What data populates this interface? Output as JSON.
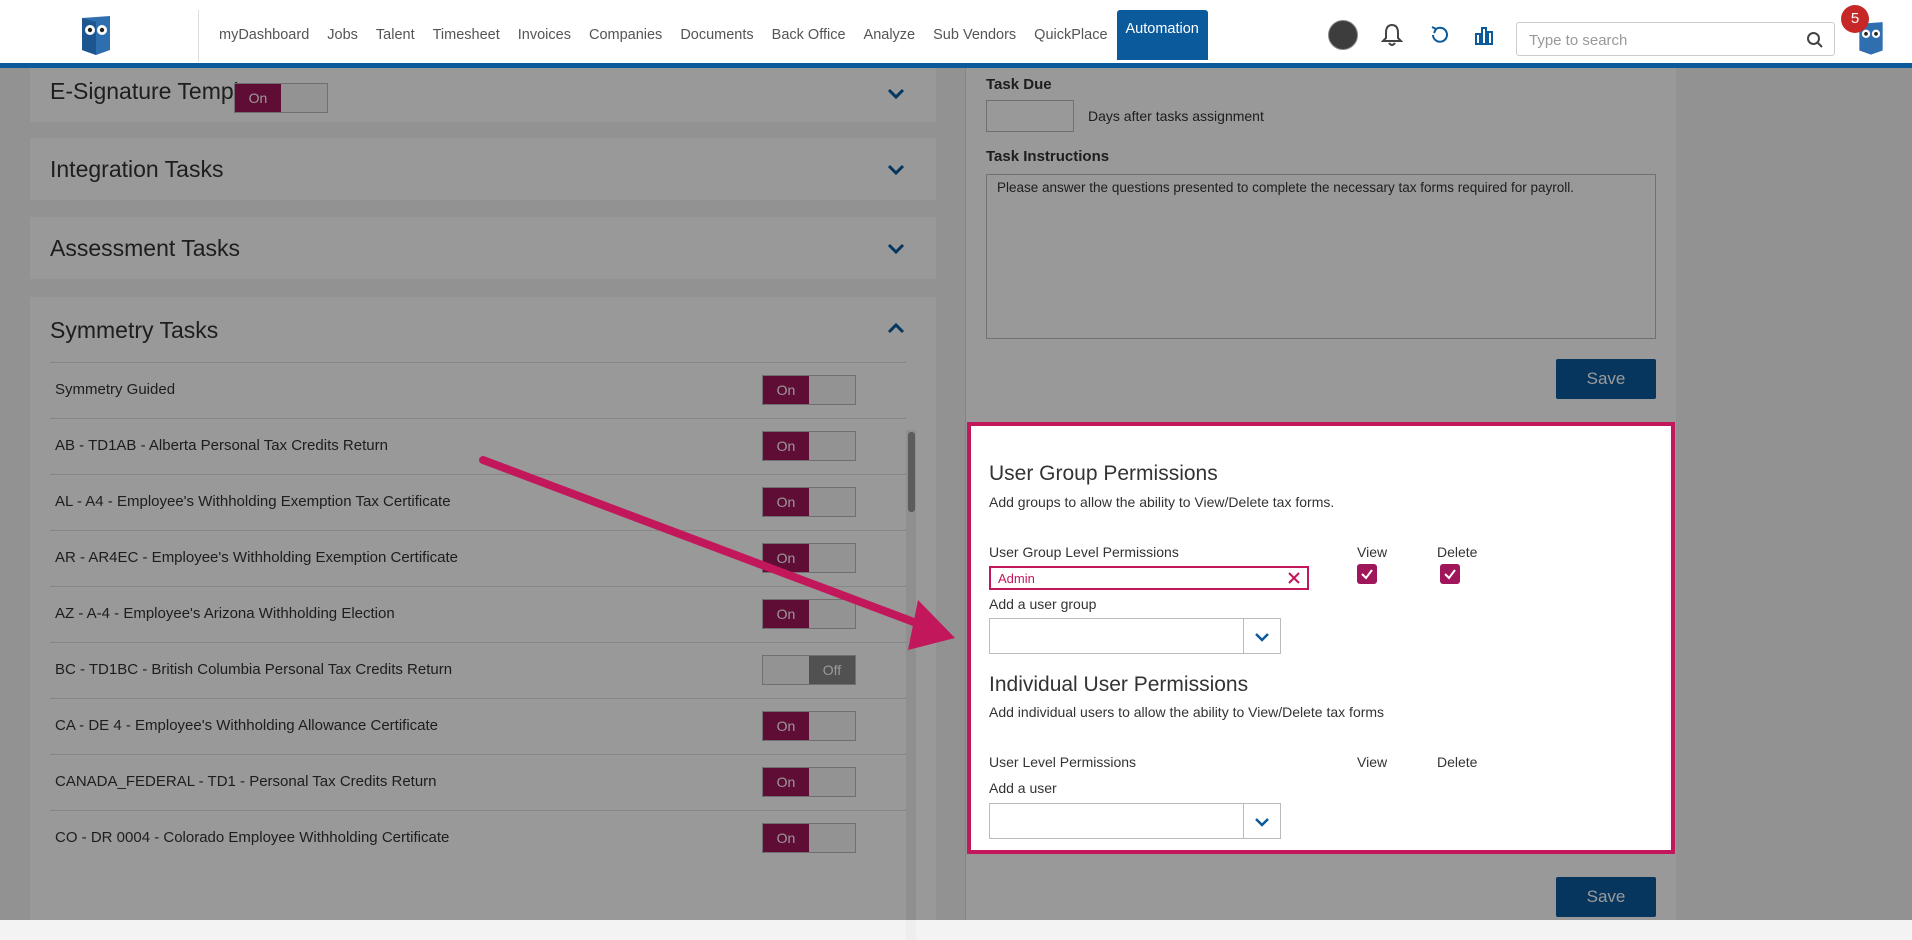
{
  "nav": {
    "items": [
      "myDashboard",
      "Jobs",
      "Talent",
      "Timesheet",
      "Invoices",
      "Companies",
      "Documents",
      "Back Office",
      "Analyze",
      "Sub Vendors",
      "QuickPlace",
      "Automation"
    ],
    "active": "Automation"
  },
  "search": {
    "placeholder": "Type to search"
  },
  "notifications": {
    "count": "5"
  },
  "accordions": {
    "esign": "E-Signature Templates",
    "integration": "Integration Tasks",
    "assessment": "Assessment Tasks",
    "symmetry": "Symmetry Tasks",
    "symmetry_toggle": "On"
  },
  "tasks": [
    {
      "label": "Symmetry Guided",
      "state": "On"
    },
    {
      "label": "AB - TD1AB - Alberta Personal Tax Credits Return",
      "state": "On"
    },
    {
      "label": "AL - A4 - Employee's Withholding Exemption Tax Certificate",
      "state": "On"
    },
    {
      "label": "AR - AR4EC - Employee's Withholding Exemption Certificate",
      "state": "On"
    },
    {
      "label": "AZ - A-4 - Employee's Arizona Withholding Election",
      "state": "On"
    },
    {
      "label": "BC - TD1BC - British Columbia Personal Tax Credits Return",
      "state": "Off"
    },
    {
      "label": "CA - DE 4 - Employee's Withholding Allowance Certificate",
      "state": "On"
    },
    {
      "label": "CANADA_FEDERAL - TD1 - Personal Tax Credits Return",
      "state": "On"
    },
    {
      "label": "CO - DR 0004 - Colorado Employee Withholding Certificate",
      "state": "On"
    }
  ],
  "task_due": {
    "label": "Task Due",
    "value": "",
    "suffix": "Days after tasks assignment"
  },
  "task_instructions": {
    "label": "Task Instructions",
    "value": "Please answer the questions presented to complete the necessary tax forms required for payroll."
  },
  "save_label": "Save",
  "permissions": {
    "group_title": "User Group Permissions",
    "group_sub": "Add groups to allow the ability to View/Delete tax forms.",
    "group_level_label": "User Group Level Permissions",
    "view_label": "View",
    "delete_label": "Delete",
    "group_tag": "Admin",
    "add_group_label": "Add a user group",
    "user_title": "Individual User Permissions",
    "user_sub": "Add individual users to allow the ability to View/Delete tax forms",
    "user_level_label": "User Level Permissions",
    "add_user_label": "Add a user"
  },
  "colors": {
    "brand": "#0a5a9c",
    "accent": "#a0165a",
    "highlight": "#c2185b"
  }
}
